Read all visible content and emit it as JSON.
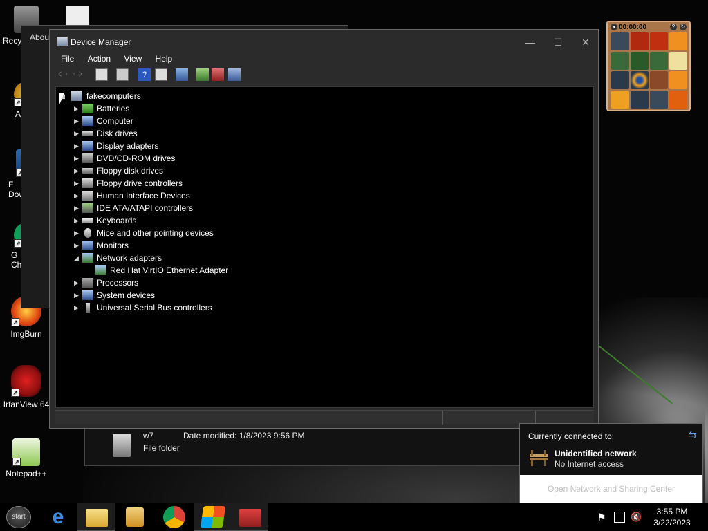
{
  "desktop": {
    "icons": [
      {
        "label": "Recy"
      },
      {
        "label": "A"
      },
      {
        "label": "F\nDow"
      },
      {
        "label": "G\nCh"
      },
      {
        "label": "ImgBurn"
      },
      {
        "label": "IrfanView 64"
      },
      {
        "label": "Notepad++"
      }
    ]
  },
  "about_window": {
    "title": "Abou"
  },
  "device_manager": {
    "title": "Device Manager",
    "menu": [
      "File",
      "Action",
      "View",
      "Help"
    ],
    "root": "fakecomputers",
    "categories": [
      {
        "label": "Batteries",
        "expanded": false
      },
      {
        "label": "Computer",
        "expanded": false
      },
      {
        "label": "Disk drives",
        "expanded": false
      },
      {
        "label": "Display adapters",
        "expanded": false
      },
      {
        "label": "DVD/CD-ROM drives",
        "expanded": false
      },
      {
        "label": "Floppy disk drives",
        "expanded": false
      },
      {
        "label": "Floppy drive controllers",
        "expanded": false
      },
      {
        "label": "Human Interface Devices",
        "expanded": false
      },
      {
        "label": "IDE ATA/ATAPI controllers",
        "expanded": false
      },
      {
        "label": "Keyboards",
        "expanded": false
      },
      {
        "label": "Mice and other pointing devices",
        "expanded": false
      },
      {
        "label": "Monitors",
        "expanded": false
      },
      {
        "label": "Network adapters",
        "expanded": true
      },
      {
        "label": "Red Hat VirtIO Ethernet Adapter",
        "child": true
      },
      {
        "label": "Processors",
        "expanded": false
      },
      {
        "label": "System devices",
        "expanded": false
      },
      {
        "label": "Universal Serial Bus controllers",
        "expanded": false
      }
    ]
  },
  "explorer_fragment": {
    "name": "w7",
    "date_modified": "Date modified: 1/8/2023 9:56 PM",
    "type": "File folder"
  },
  "gadget": {
    "timer": "00:00:00"
  },
  "network_flyout": {
    "header": "Currently connected to:",
    "network_name": "Unidentified network",
    "network_status": "No Internet access",
    "footer_link": "Open Network and Sharing Center"
  },
  "taskbar": {
    "start_label": "start",
    "time": "3:55 PM",
    "date": "3/22/2023"
  },
  "colors": {
    "accent": "#6aa0e0",
    "window_bg": "#2b2b2b",
    "tree_bg": "#000000"
  }
}
